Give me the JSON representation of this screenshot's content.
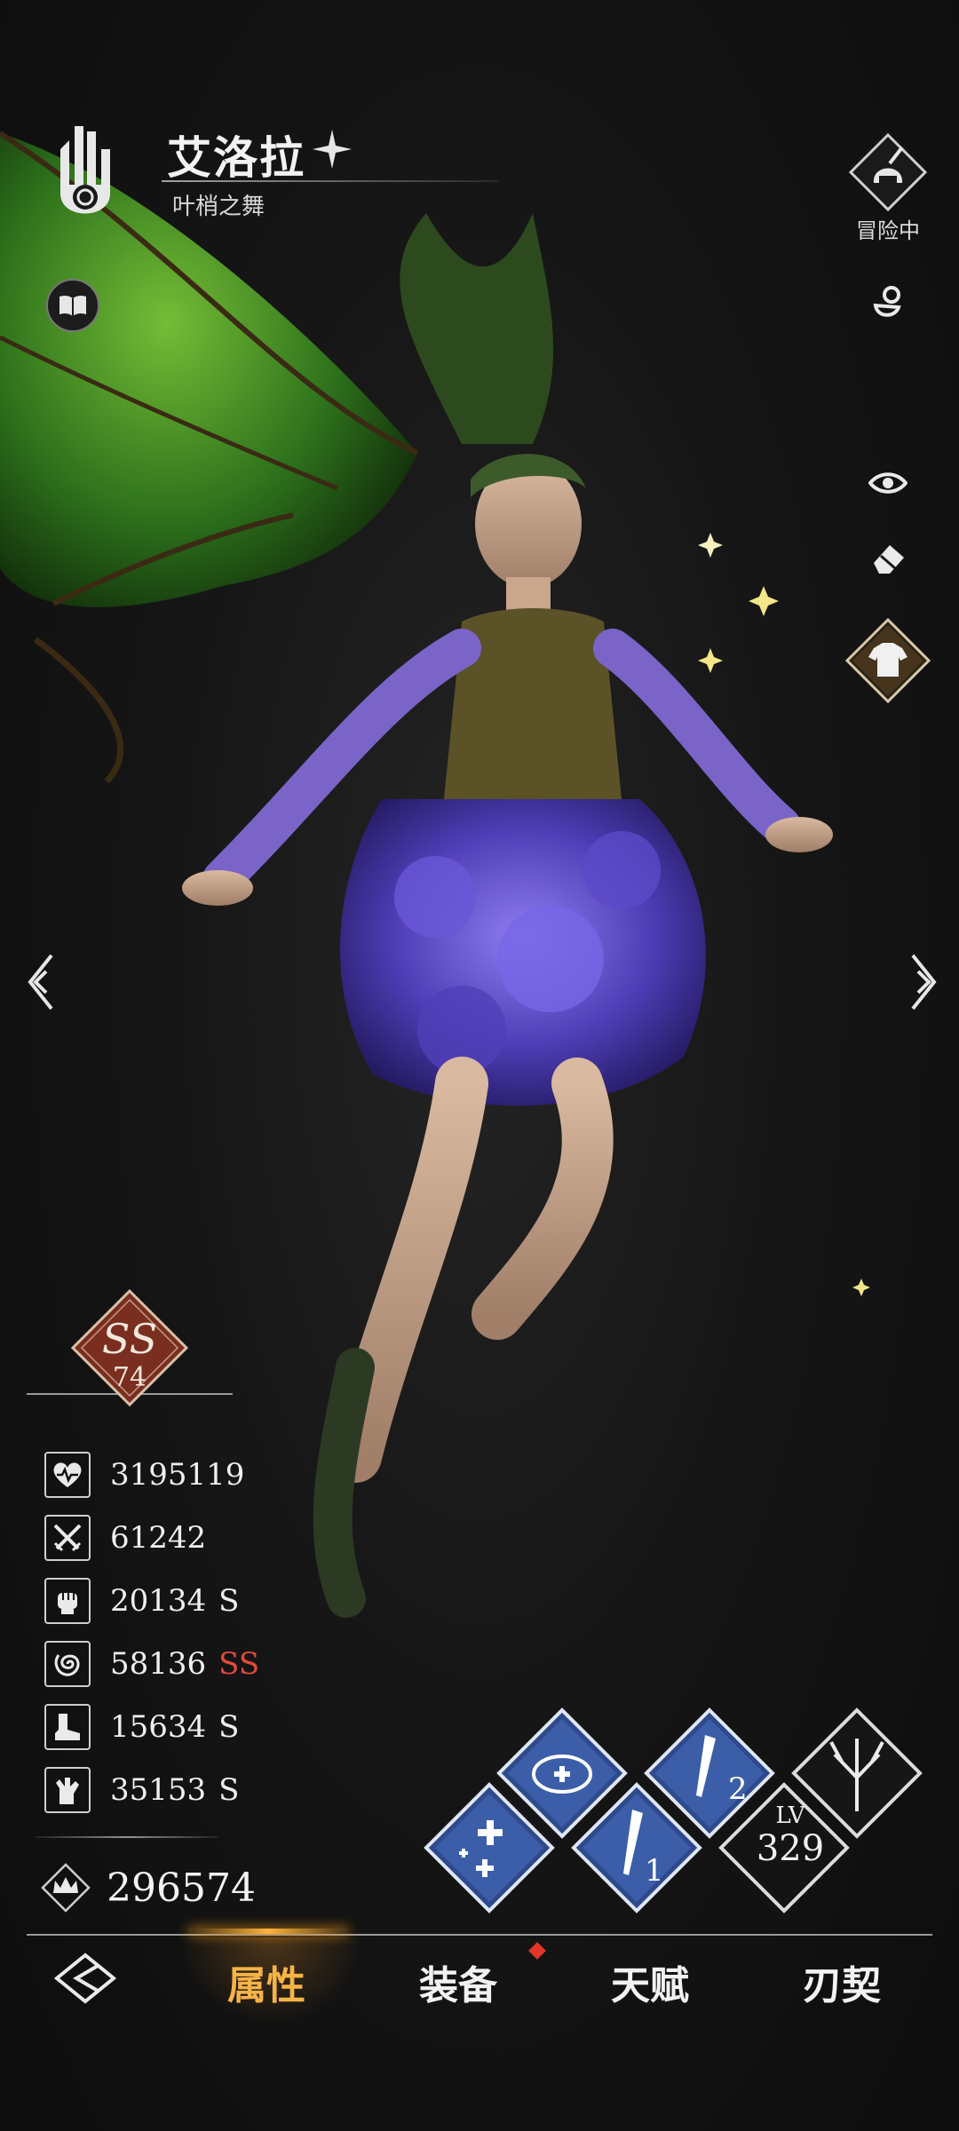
{
  "header": {
    "name": "艾洛拉",
    "title": "叶梢之舞",
    "emblem_icon": "palm-emblem-icon",
    "star_icon": "four-point-star-icon",
    "lore_icon": "book-icon"
  },
  "right_rail": {
    "adventure_label": "冒险中",
    "icons": [
      "adventure-helmet-icon",
      "pacifier-icon",
      "eye-icon",
      "eraser-icon",
      "outfit-icon"
    ]
  },
  "rank": {
    "grade": "SS",
    "level": "74"
  },
  "stats": [
    {
      "icon": "hp-heart-icon",
      "value": "3195119",
      "grade": ""
    },
    {
      "icon": "attack-swords-icon",
      "value": "61242",
      "grade": ""
    },
    {
      "icon": "fist-icon",
      "value": "20134",
      "grade": "S"
    },
    {
      "icon": "spiral-icon",
      "value": "58136",
      "grade": "SS"
    },
    {
      "icon": "boot-icon",
      "value": "15634",
      "grade": "S"
    },
    {
      "icon": "hand-icon",
      "value": "35153",
      "grade": "S"
    }
  ],
  "power": {
    "icon": "crown-power-icon",
    "value": "296574"
  },
  "skills": {
    "level_label": "LV",
    "level": "329",
    "slot_1": "1",
    "slot_2": "2"
  },
  "nav": {
    "tabs": [
      "属性",
      "装备",
      "天赋",
      "刃契"
    ],
    "active": "属性",
    "back_icon": "back-arrow-icon"
  },
  "colors": {
    "accent": "#f6b347",
    "grade_red": "#e2493f",
    "skill_blue": "#3c5ea8"
  }
}
